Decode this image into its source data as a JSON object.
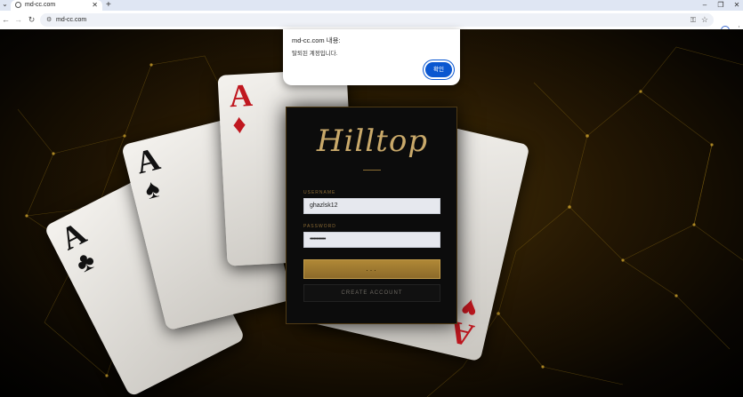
{
  "browser": {
    "tab_title": "md-cc.com",
    "url": "md-cc.com",
    "new_tab_symbol": "+",
    "tab_close_symbol": "✕",
    "window_controls": {
      "minimize": "–",
      "restore": "❐",
      "close": "✕"
    }
  },
  "dialog": {
    "title": "md-cc.com 내용:",
    "message": "탈퇴된 계정입니다.",
    "ok_label": "확인",
    "accent": "#0b57d0"
  },
  "login": {
    "logo_text": "Hilltop",
    "username_label": "USERNAME",
    "username_value": "ghazlsk12",
    "password_label": "PASSWORD",
    "password_value": "••••••••••••",
    "login_button": "...",
    "create_account_button": "CREATE ACCOUNT",
    "gold": "#b08836"
  },
  "background": {
    "cards": [
      {
        "rank": "A",
        "suit": "♣",
        "color": "#111111"
      },
      {
        "rank": "A",
        "suit": "♠",
        "color": "#111111"
      },
      {
        "rank": "A",
        "suit": "♦",
        "color": "#c0171f"
      },
      {
        "rank": "A",
        "suit": "♥",
        "color": "#c0171f"
      }
    ]
  }
}
